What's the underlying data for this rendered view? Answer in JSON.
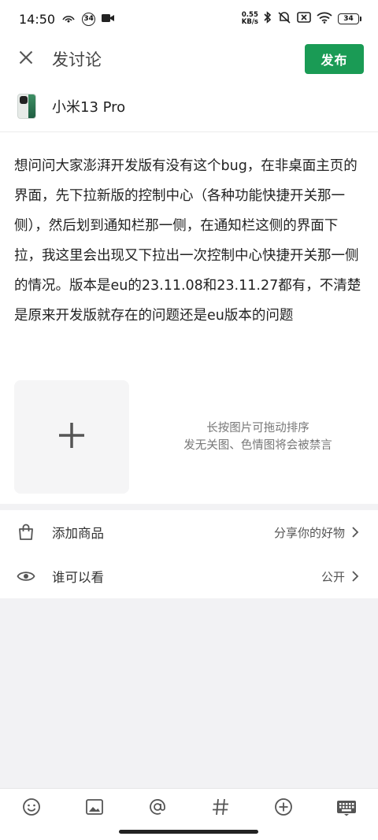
{
  "status_bar": {
    "time": "14:50",
    "notif_badge": "34",
    "net_speed_value": "0.55",
    "net_speed_unit": "KB/s",
    "battery": "34"
  },
  "header": {
    "title": "发讨论",
    "publish_label": "发布"
  },
  "device": {
    "name": "小米13 Pro"
  },
  "post": {
    "body": "想问问大家澎湃开发版有没有这个bug，在非桌面主页的界面，先下拉新版的控制中心（各种功能快捷开关那一侧），然后划到通知栏那一侧，在通知栏这侧的界面下拉，我这里会出现又下拉出一次控制中心快捷开关那一侧的情况。版本是eu的23.11.08和23.11.27都有，不清楚是原来开发版就存在的问题还是eu版本的问题"
  },
  "image_upload": {
    "hint_line1": "长按图片可拖动排序",
    "hint_line2": "发无关图、色情图将会被禁言"
  },
  "options": [
    {
      "label": "添加商品",
      "value": "分享你的好物",
      "icon": "shopping-bag-icon"
    },
    {
      "label": "谁可以看",
      "value": "公开",
      "icon": "eye-icon"
    }
  ],
  "toolbar": {
    "icons": [
      "emoji-icon",
      "image-icon",
      "mention-icon",
      "hashtag-icon",
      "add-circle-icon",
      "keyboard-icon"
    ]
  },
  "colors": {
    "accent": "#1a9b55"
  }
}
